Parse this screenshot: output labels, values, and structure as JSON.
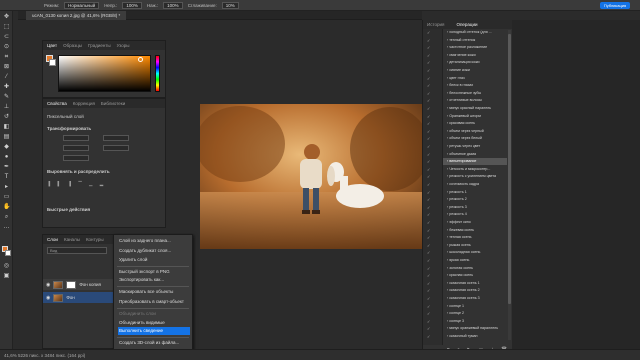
{
  "options_bar": {
    "mode_label": "Режим:",
    "mode_value": "Нормальный",
    "opacity_label": "Непр.:",
    "opacity_value": "100%",
    "flow_label": "Наж.:",
    "flow_value": "100%",
    "smoothing_label": "Сглаживание:",
    "smoothing_value": "10%",
    "publish_label": "Публикация"
  },
  "document_tab": {
    "title": "ucAN_0130 копия 2.jpg @ 41,6% (RGB/8) *"
  },
  "color_panel": {
    "tabs": [
      "Цвет",
      "Образцы",
      "Градиенты",
      "Узоры"
    ],
    "foreground": "#e37a2c",
    "background": "#ffffff"
  },
  "properties_panel": {
    "tabs": [
      "Свойства",
      "Коррекция",
      "Библиотеки"
    ],
    "layer_type": "Пиксельный слой",
    "transform_section": "Трансформировать",
    "align_section": "Выровнять и распределить",
    "quick_actions_section": "Быстрые действия"
  },
  "layers_panel": {
    "tabs": [
      "Слои",
      "Каналы",
      "Контуры"
    ],
    "filter_placeholder": "Вид",
    "layers": [
      {
        "name": "Фон копия"
      },
      {
        "name": "Фон"
      }
    ]
  },
  "context_menu": {
    "items": [
      {
        "label": "Слой из заднего плана...",
        "disabled": false,
        "selected": false
      },
      {
        "label": "Создать дубликат слоя...",
        "disabled": false,
        "selected": false
      },
      {
        "label": "Удалить слой",
        "disabled": false,
        "selected": false
      },
      {
        "label": "Быстрый экспорт в PNG",
        "disabled": false,
        "selected": false
      },
      {
        "label": "Экспортировать как...",
        "disabled": false,
        "selected": false
      },
      {
        "label": "Маскировать все объекты",
        "disabled": false,
        "selected": false
      },
      {
        "label": "Преобразовать в смарт-объект",
        "disabled": false,
        "selected": false
      },
      {
        "label": "Объединить слои",
        "disabled": true,
        "selected": false
      },
      {
        "label": "Объединить видимые",
        "disabled": false,
        "selected": false
      },
      {
        "label": "Выполнить сведение",
        "disabled": false,
        "selected": true
      },
      {
        "label": "Создать 3D-слой из файла...",
        "disabled": false,
        "selected": false
      },
      {
        "label": "Почтовая открытка",
        "disabled": false,
        "selected": false
      }
    ]
  },
  "history_panel": {
    "tabs": [
      "История",
      "Операции"
    ],
    "items": [
      {
        "label": "холодный оттенок (для ...",
        "active": false
      },
      {
        "label": "теплый оттенок",
        "active": false
      },
      {
        "label": "частотное разложение",
        "active": false
      },
      {
        "label": "смягчение кожи",
        "active": false
      },
      {
        "label": "детализация кожи",
        "active": false
      },
      {
        "label": "сияние кожи",
        "active": false
      },
      {
        "label": "цвет глаз",
        "active": false
      },
      {
        "label": "блеск в глазах",
        "active": false
      },
      {
        "label": "белоснежные зубы",
        "active": false
      },
      {
        "label": "отчетливые волосы",
        "active": false
      },
      {
        "label": "минус красный паралель",
        "active": false
      },
      {
        "label": "Оранжевый шторм",
        "active": false
      },
      {
        "label": "красивая осень",
        "active": false
      },
      {
        "label": "объем через черный",
        "active": false
      },
      {
        "label": "объем через белый",
        "active": false
      },
      {
        "label": "ретушь через цвет",
        "active": false
      },
      {
        "label": "объемное дыма",
        "active": false
      },
      {
        "label": "виньетирование",
        "active": true
      },
      {
        "label": "Четкость и микроконтр...",
        "active": false
      },
      {
        "label": "резкость с усилением цвета",
        "active": false
      },
      {
        "label": "сочтимость кадра",
        "active": false
      },
      {
        "label": "резкость 1",
        "active": false
      },
      {
        "label": "резкость 2",
        "active": false
      },
      {
        "label": "резкость 3",
        "active": false
      },
      {
        "label": "резкость 4",
        "active": false
      },
      {
        "label": "эффект кино",
        "active": false
      },
      {
        "label": "бежевая осень",
        "active": false
      },
      {
        "label": "теплая осень",
        "active": false
      },
      {
        "label": "рыжая осень",
        "active": false
      },
      {
        "label": "шоколадная осень",
        "active": false
      },
      {
        "label": "яркая осень",
        "active": false
      },
      {
        "label": "золотая осень",
        "active": false
      },
      {
        "label": "красная осень",
        "active": false
      },
      {
        "label": "сказочная осень 1",
        "active": false
      },
      {
        "label": "сказочная осень 2",
        "active": false
      },
      {
        "label": "сказочная осень 3",
        "active": false
      },
      {
        "label": "солнце 1",
        "active": false
      },
      {
        "label": "солнце 2",
        "active": false
      },
      {
        "label": "солнце 3",
        "active": false
      },
      {
        "label": "минус оранжевый параллель",
        "active": false
      },
      {
        "label": "сказочный туман",
        "active": false
      }
    ]
  },
  "status_bar": {
    "text": "41,6%   5226 пикс. x 3484 пикс. (164 ppi)"
  }
}
